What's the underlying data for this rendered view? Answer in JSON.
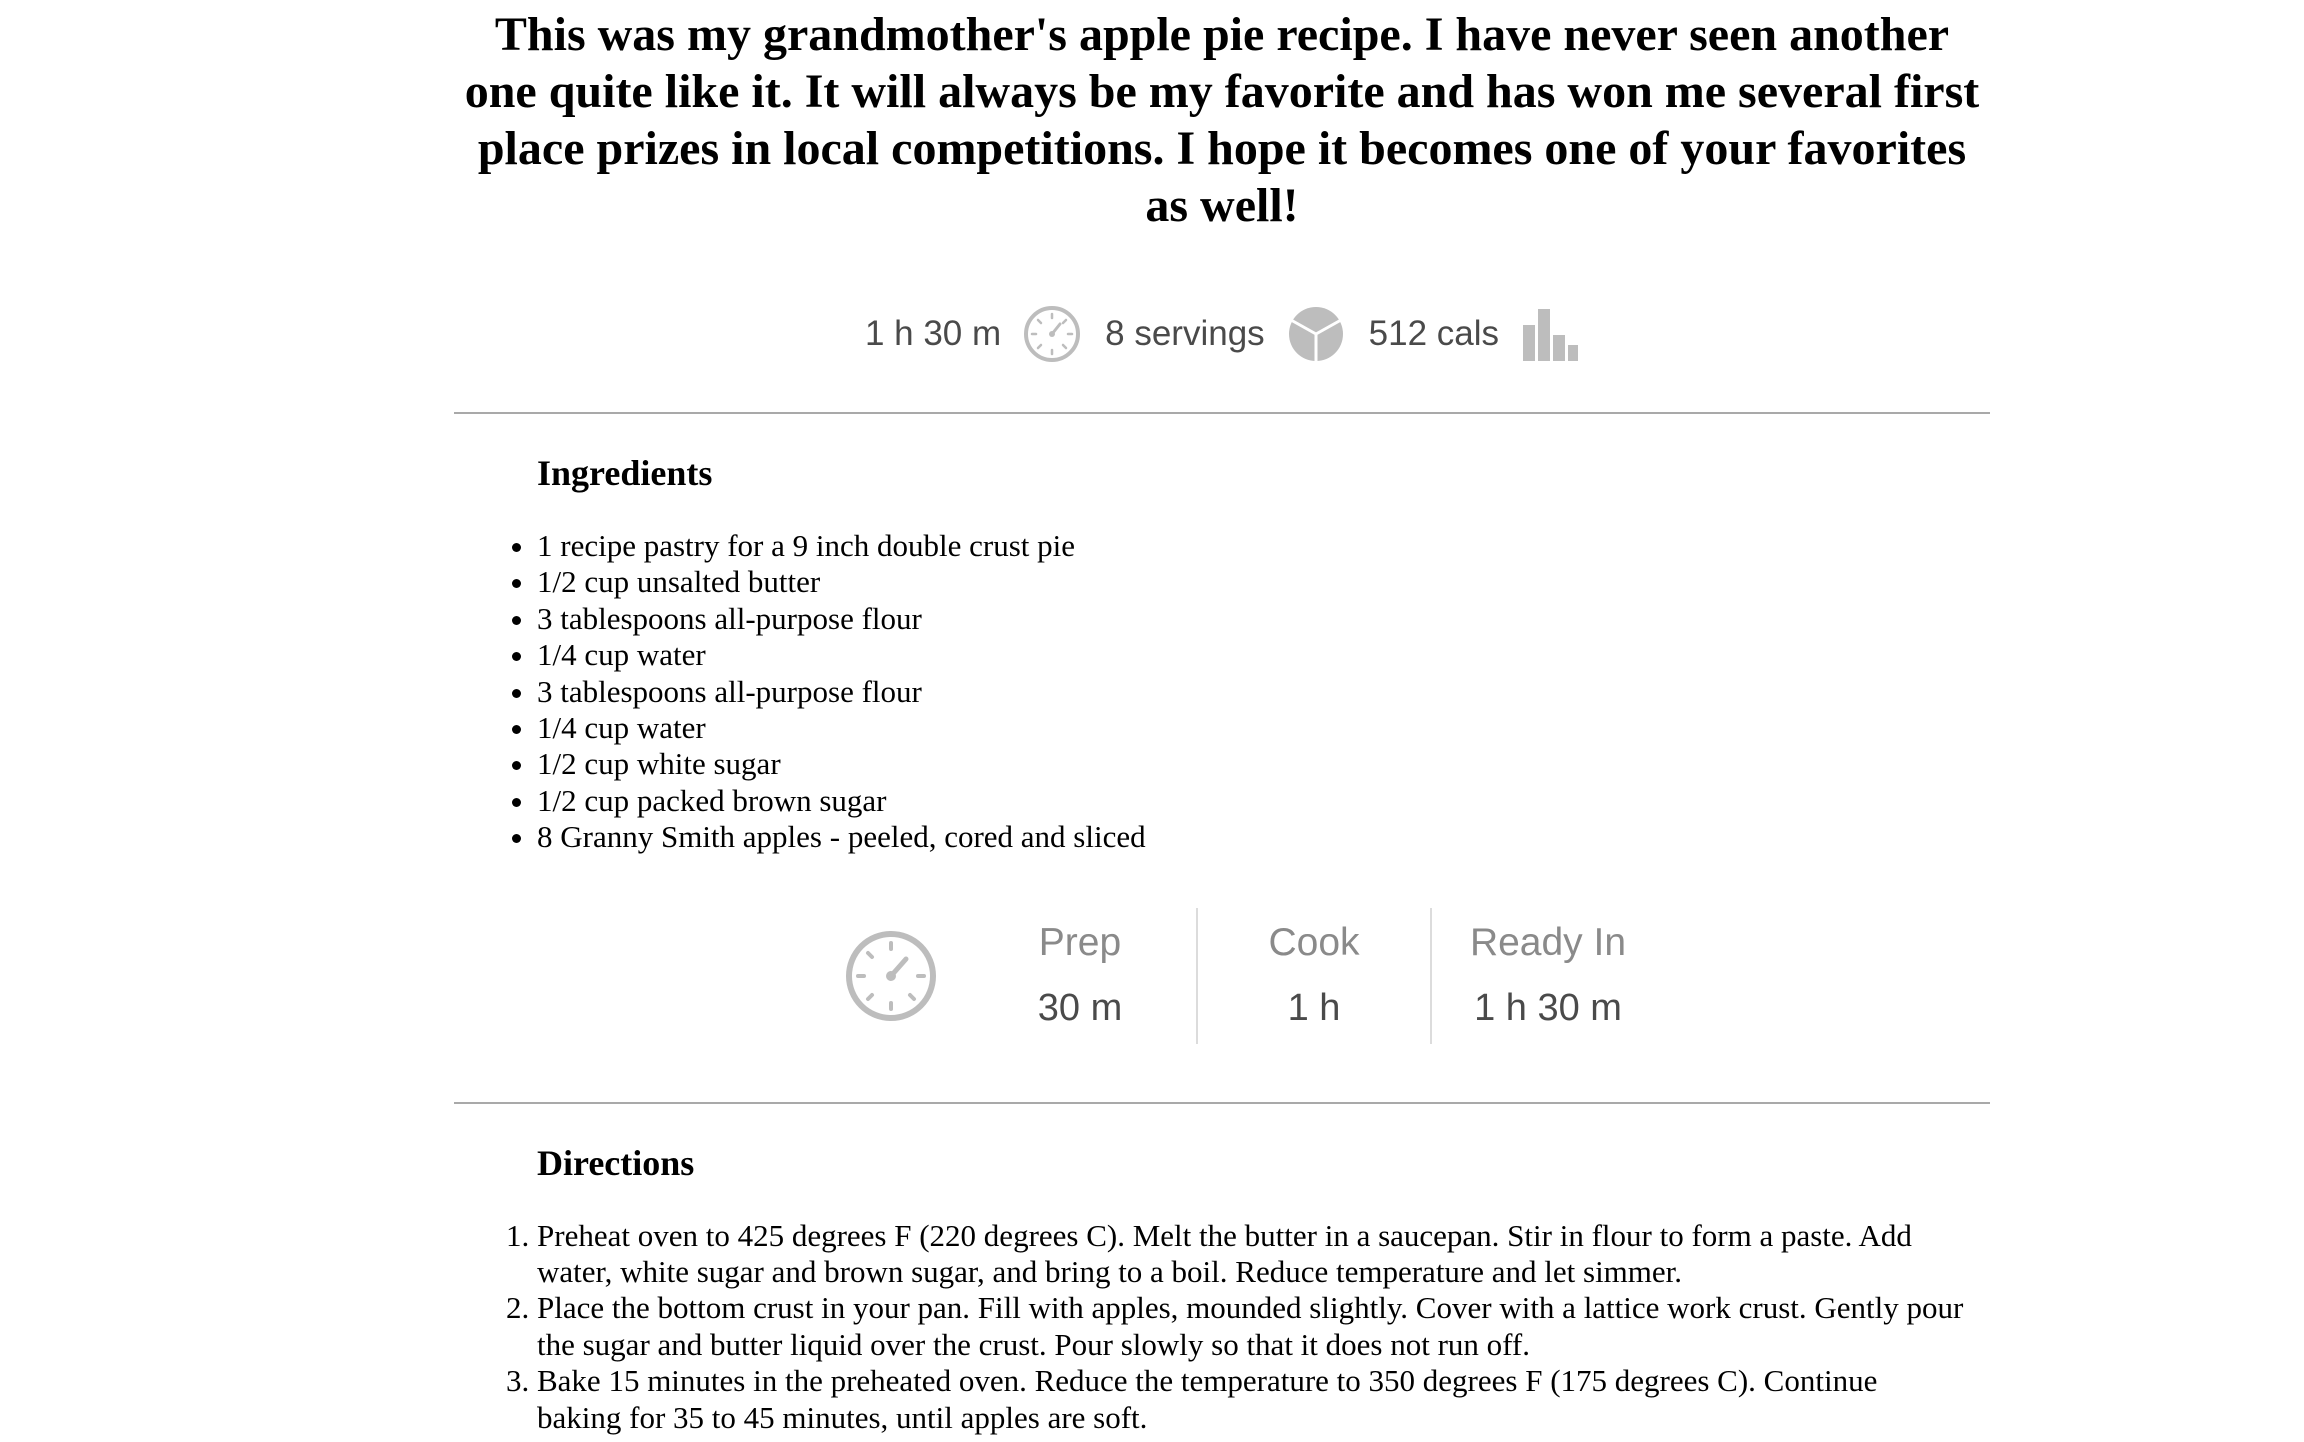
{
  "description": "This was my grandmother's apple pie recipe. I have never seen another one quite like it. It will always be my favorite and has won me several first place prizes in local competitions. I hope it becomes one of your favorites as well!",
  "summary": {
    "total_time": "1 h 30 m",
    "total_time_icon": "clock-icon",
    "servings": "8 servings",
    "servings_icon": "pie-chart-icon",
    "calories": "512 cals",
    "calories_icon": "bar-chart-icon"
  },
  "ingredients": {
    "title": "Ingredients",
    "items": [
      "1 recipe pastry for a 9 inch double crust pie",
      "1/2 cup unsalted butter",
      "3 tablespoons all-purpose flour",
      "1/4 cup water",
      "3 tablespoons all-purpose flour",
      "1/4 cup water",
      "1/2 cup white sugar",
      "1/2 cup packed brown sugar",
      "8 Granny Smith apples - peeled, cored and sliced"
    ]
  },
  "times": {
    "icon": "stopwatch-icon",
    "prep_label": "Prep",
    "prep_value": "30 m",
    "cook_label": "Cook",
    "cook_value": "1 h",
    "ready_label": "Ready In",
    "ready_value": "1 h 30 m"
  },
  "directions": {
    "title": "Directions",
    "steps": [
      "Preheat oven to 425 degrees F (220 degrees C). Melt the butter in a saucepan. Stir in flour to form a paste. Add water, white sugar and brown sugar, and bring to a boil. Reduce temperature and let simmer.",
      "Place the bottom crust in your pan. Fill with apples, mounded slightly. Cover with a lattice work crust. Gently pour the sugar and butter liquid over the crust. Pour slowly so that it does not run off.",
      "Bake 15 minutes in the preheated oven. Reduce the temperature to 350 degrees F (175 degrees C). Continue baking for 35 to 45 minutes, until apples are soft."
    ]
  },
  "colors": {
    "icon_gray": "#bdbdbd",
    "rule": "#a9a9a9",
    "meta_text": "#4a4a4a"
  }
}
